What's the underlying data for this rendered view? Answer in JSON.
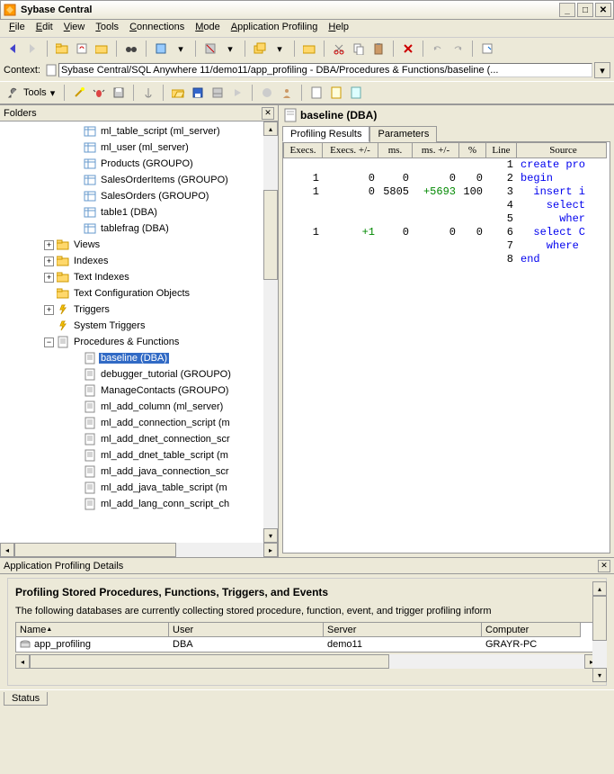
{
  "window": {
    "title": "Sybase Central"
  },
  "menus": [
    "File",
    "Edit",
    "View",
    "Tools",
    "Connections",
    "Mode",
    "Application Profiling",
    "Help"
  ],
  "context": {
    "label": "Context:",
    "value": "Sybase Central/SQL Anywhere 11/demo11/app_profiling - DBA/Procedures & Functions/baseline (..."
  },
  "tools_label": "Tools",
  "folders": {
    "title": "Folders",
    "items": [
      {
        "indent": 5,
        "icon": "table",
        "label": "ml_table_script (ml_server)"
      },
      {
        "indent": 5,
        "icon": "table",
        "label": "ml_user (ml_server)"
      },
      {
        "indent": 5,
        "icon": "table",
        "label": "Products (GROUPO)"
      },
      {
        "indent": 5,
        "icon": "table",
        "label": "SalesOrderItems (GROUPO)"
      },
      {
        "indent": 5,
        "icon": "table",
        "label": "SalesOrders (GROUPO)"
      },
      {
        "indent": 5,
        "icon": "table",
        "label": "table1 (DBA)"
      },
      {
        "indent": 5,
        "icon": "table",
        "label": "tablefrag (DBA)"
      },
      {
        "indent": 3,
        "exp": "+",
        "icon": "folder",
        "label": "Views"
      },
      {
        "indent": 3,
        "exp": "+",
        "icon": "folder",
        "label": "Indexes"
      },
      {
        "indent": 3,
        "exp": "+",
        "icon": "folder",
        "label": "Text Indexes"
      },
      {
        "indent": 3,
        "icon": "folder",
        "label": "Text Configuration Objects"
      },
      {
        "indent": 3,
        "exp": "+",
        "icon": "trigger",
        "label": "Triggers"
      },
      {
        "indent": 3,
        "icon": "trigger",
        "label": "System Triggers"
      },
      {
        "indent": 3,
        "exp": "-",
        "icon": "doc",
        "label": "Procedures & Functions"
      },
      {
        "indent": 5,
        "icon": "doc",
        "label": "baseline (DBA)",
        "selected": true
      },
      {
        "indent": 5,
        "icon": "doc",
        "label": "debugger_tutorial (GROUPO)"
      },
      {
        "indent": 5,
        "icon": "doc",
        "label": "ManageContacts (GROUPO)"
      },
      {
        "indent": 5,
        "icon": "doc",
        "label": "ml_add_column (ml_server)"
      },
      {
        "indent": 5,
        "icon": "doc",
        "label": "ml_add_connection_script (m"
      },
      {
        "indent": 5,
        "icon": "doc",
        "label": "ml_add_dnet_connection_scr"
      },
      {
        "indent": 5,
        "icon": "doc",
        "label": "ml_add_dnet_table_script (m"
      },
      {
        "indent": 5,
        "icon": "doc",
        "label": "ml_add_java_connection_scr"
      },
      {
        "indent": 5,
        "icon": "doc",
        "label": "ml_add_java_table_script (m"
      },
      {
        "indent": 5,
        "icon": "doc",
        "label": "ml_add_lang_conn_script_ch"
      }
    ]
  },
  "right": {
    "title": "baseline (DBA)",
    "tabs": [
      "Profiling Results",
      "Parameters"
    ],
    "active_tab": 0,
    "columns": [
      "Execs.",
      "Execs. +/-",
      "ms.",
      "ms. +/-",
      "%",
      "Line",
      "Source"
    ],
    "rows": [
      {
        "execs": "",
        "execsd": "",
        "ms": "",
        "msd": "",
        "pct": "",
        "line": "1",
        "src": "create pro",
        "cls": "k-blue"
      },
      {
        "execs": "1",
        "execsd": "0",
        "ms": "0",
        "msd": "0",
        "pct": "0",
        "line": "2",
        "src": "begin",
        "cls": "k-blue"
      },
      {
        "execs": "1",
        "execsd": "0",
        "ms": "5805",
        "msd": "+5693",
        "pct": "100",
        "line": "3",
        "src": "  insert i",
        "cls": "k-blue",
        "msd_cls": "k-green"
      },
      {
        "execs": "",
        "execsd": "",
        "ms": "",
        "msd": "",
        "pct": "",
        "line": "4",
        "src": "    select",
        "cls": "k-blue"
      },
      {
        "execs": "",
        "execsd": "",
        "ms": "",
        "msd": "",
        "pct": "",
        "line": "5",
        "src": "      wher",
        "cls": "k-blue"
      },
      {
        "execs": "1",
        "execsd": "+1",
        "ms": "0",
        "msd": "0",
        "pct": "0",
        "line": "6",
        "src": "  select C",
        "cls": "k-blue",
        "execsd_cls": "k-green"
      },
      {
        "execs": "",
        "execsd": "",
        "ms": "",
        "msd": "",
        "pct": "",
        "line": "7",
        "src": "    where",
        "cls": "k-blue"
      },
      {
        "execs": "",
        "execsd": "",
        "ms": "",
        "msd": "",
        "pct": "",
        "line": "8",
        "src": "end",
        "cls": "k-blue"
      }
    ]
  },
  "details": {
    "title": "Application Profiling Details",
    "heading": "Profiling Stored Procedures, Functions, Triggers, and Events",
    "text": "The following databases are currently collecting stored procedure, function, event, and trigger profiling inform",
    "columns": [
      "Name",
      "User",
      "Server",
      "Computer"
    ],
    "row": {
      "name": "app_profiling",
      "user": "DBA",
      "server": "demo11",
      "computer": "GRAYR-PC"
    }
  },
  "status": {
    "label": "Status"
  }
}
